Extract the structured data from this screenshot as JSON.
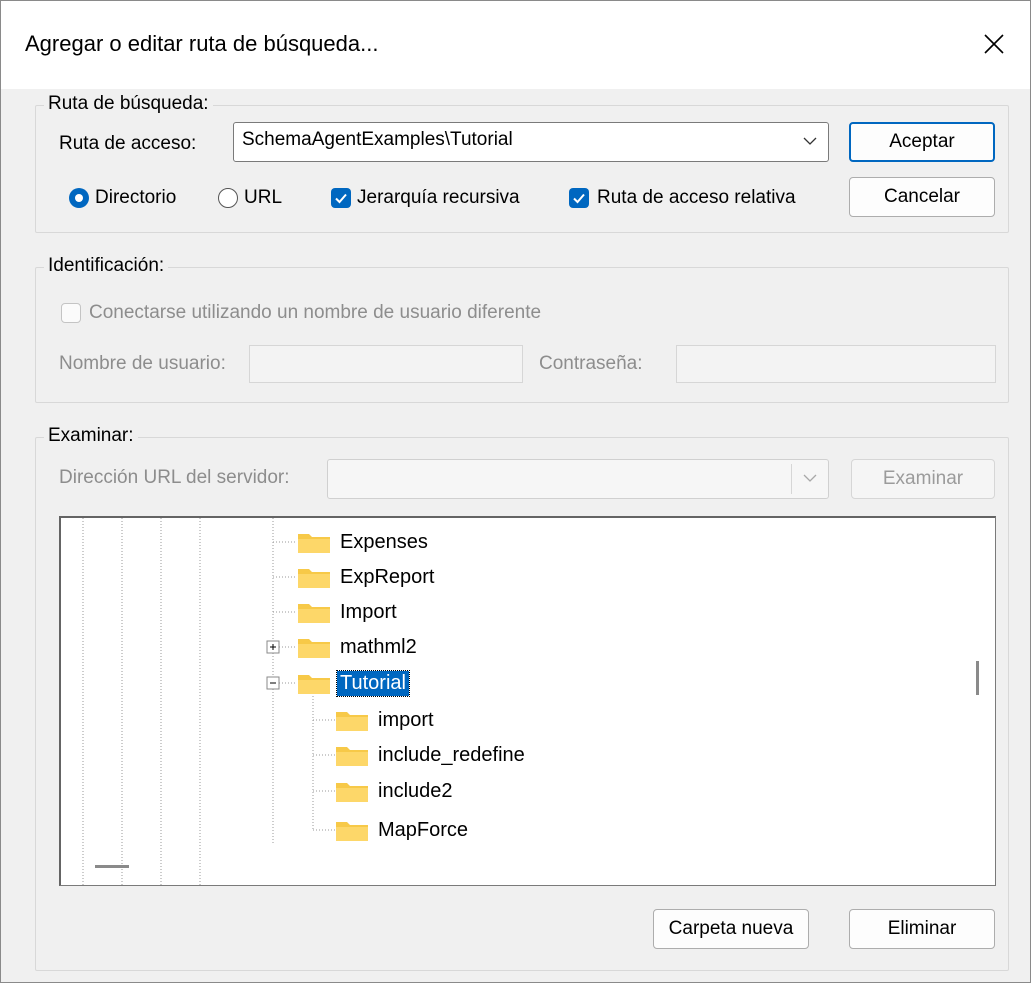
{
  "dialog": {
    "title": "Agregar o editar ruta de búsqueda..."
  },
  "search_path": {
    "group_label": "Ruta de búsqueda:",
    "path_label": "Ruta de acceso:",
    "path_value": "SchemaAgentExamples\\Tutorial",
    "radio_directory": "Directorio",
    "radio_url": "URL",
    "check_recursive": "Jerarquía recursiva",
    "check_relative": "Ruta de acceso relativa",
    "ok_label": "Aceptar",
    "cancel_label": "Cancelar"
  },
  "identification": {
    "group_label": "Identificación:",
    "check_connect": "Conectarse utilizando un nombre de usuario diferente",
    "username_label": "Nombre de usuario:",
    "password_label": "Contraseña:"
  },
  "browse": {
    "group_label": "Examinar:",
    "server_url_label": "Dirección URL del servidor:",
    "browse_button": "Examinar",
    "tree": [
      {
        "label": "Expenses"
      },
      {
        "label": "ExpReport"
      },
      {
        "label": "Import"
      },
      {
        "label": "mathml2"
      },
      {
        "label": "Tutorial"
      },
      {
        "label": "import"
      },
      {
        "label": "include_redefine"
      },
      {
        "label": "include2"
      },
      {
        "label": "MapForce"
      }
    ],
    "new_folder_button": "Carpeta nueva",
    "delete_button": "Eliminar"
  },
  "colors": {
    "accent": "#0067c0",
    "folder": "#f7c948"
  }
}
